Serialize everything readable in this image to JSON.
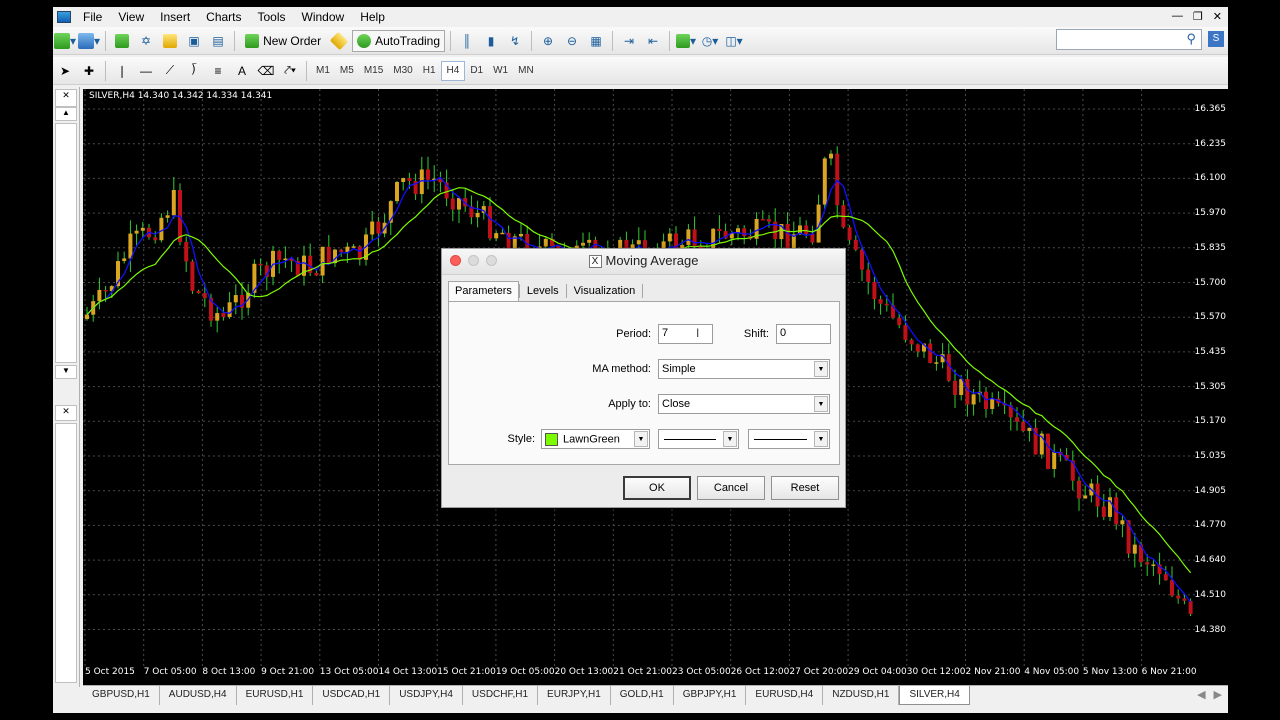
{
  "menu": [
    "File",
    "View",
    "Insert",
    "Charts",
    "Tools",
    "Window",
    "Help"
  ],
  "toolbar": {
    "new_order": "New Order",
    "autotrading": "AutoTrading",
    "timeframes": [
      "M1",
      "M5",
      "M15",
      "M30",
      "H1",
      "H4",
      "D1",
      "W1",
      "MN"
    ],
    "active_timeframe": "H4",
    "search_placeholder": ""
  },
  "chart": {
    "title": "SILVER,H4  14.340 14.342 14.334 14.341",
    "price_ticks": [
      "16.365",
      "16.235",
      "16.100",
      "15.970",
      "15.835",
      "15.700",
      "15.570",
      "15.435",
      "15.305",
      "15.170",
      "15.035",
      "14.905",
      "14.770",
      "14.640",
      "14.510",
      "14.380"
    ],
    "time_ticks": [
      "5 Oct 2015",
      "7 Oct 05:00",
      "8 Oct 13:00",
      "9 Oct 21:00",
      "13 Oct 05:00",
      "14 Oct 13:00",
      "15 Oct 21:00",
      "19 Oct 05:00",
      "20 Oct 13:00",
      "21 Oct 21:00",
      "23 Oct 05:00",
      "26 Oct 12:00",
      "27 Oct 20:00",
      "29 Oct 04:00",
      "30 Oct 12:00",
      "2 Nov 21:00",
      "4 Nov 05:00",
      "5 Nov 13:00",
      "6 Nov 21:00"
    ],
    "colors": {
      "bull": "#daa520",
      "bear": "#c0101a",
      "wick": "#32cd32",
      "ma_fast": "#1010ff",
      "ma_slow": "#7cfc00",
      "grid": "#4a4a4a"
    }
  },
  "tabs": [
    "GBPUSD,H1",
    "AUDUSD,H4",
    "EURUSD,H1",
    "USDCAD,H1",
    "USDJPY,H4",
    "USDCHF,H1",
    "EURJPY,H1",
    "GOLD,H1",
    "GBPJPY,H1",
    "EURUSD,H4",
    "NZDUSD,H1",
    "SILVER,H4"
  ],
  "active_tab": "SILVER,H4",
  "dialog": {
    "title": "Moving Average",
    "tabs": [
      "Parameters",
      "Levels",
      "Visualization"
    ],
    "period_label": "Period:",
    "period_value": "7",
    "shift_label": "Shift:",
    "shift_value": "0",
    "method_label": "MA method:",
    "method_value": "Simple",
    "apply_label": "Apply to:",
    "apply_value": "Close",
    "style_label": "Style:",
    "style_color": "LawnGreen",
    "ok": "OK",
    "cancel": "Cancel",
    "reset": "Reset"
  }
}
